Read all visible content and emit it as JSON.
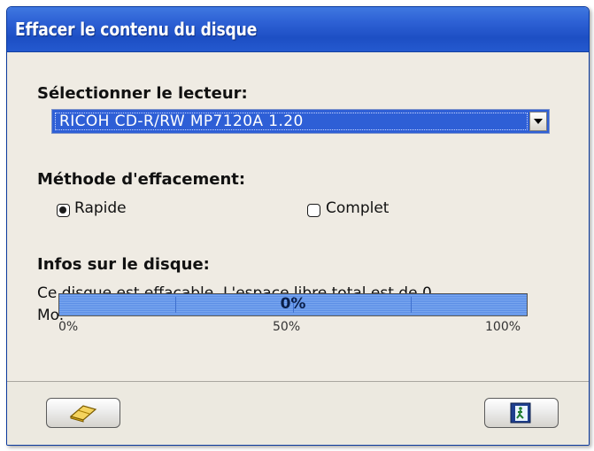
{
  "window": {
    "title": "Effacer le contenu du disque"
  },
  "drive": {
    "label": "Sélectionner le lecteur:",
    "selected": "RICOH   CD-R/RW MP7120A 1.20"
  },
  "method": {
    "label": "Méthode d'effacement:",
    "options": [
      {
        "label": "Rapide",
        "selected": true
      },
      {
        "label": "Complet",
        "selected": false
      }
    ]
  },
  "info": {
    "label": "Infos sur le disque:",
    "text_line1": "Ce disque est effaçable. L'espace libre total est de 0",
    "text_line2": "Mo."
  },
  "progress": {
    "value_text": "0%",
    "value": 0,
    "scale_min": "0%",
    "scale_mid": "50%",
    "scale_max": "100%"
  },
  "buttons": {
    "erase_icon": "eraser-icon",
    "exit_icon": "exit-door-icon"
  },
  "colors": {
    "titlebar": "#2459cf",
    "selection": "#2e5fd6",
    "progress": "#5b8ee6"
  }
}
